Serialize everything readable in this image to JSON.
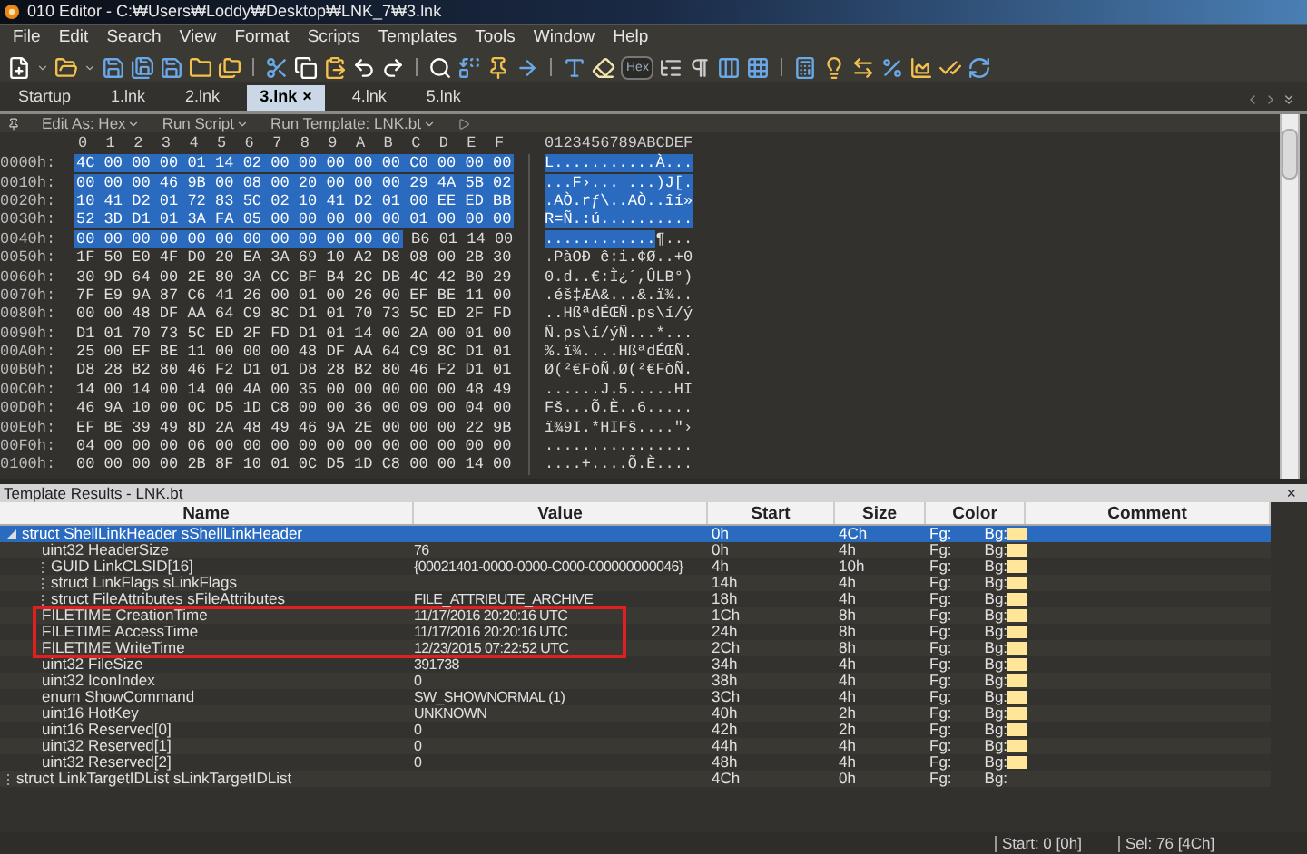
{
  "window": {
    "title": "010 Editor - C:₩Users₩Loddy₩Desktop₩LNK_7₩3.lnk"
  },
  "menu": [
    "File",
    "Edit",
    "Search",
    "View",
    "Format",
    "Scripts",
    "Templates",
    "Tools",
    "Window",
    "Help"
  ],
  "toolbar": {
    "hex_toggle": {
      "label": "Hex",
      "selected": true
    }
  },
  "tabs": [
    {
      "label": "Startup",
      "selected": false
    },
    {
      "label": "1.lnk",
      "selected": false
    },
    {
      "label": "2.lnk",
      "selected": false
    },
    {
      "label": "3.lnk",
      "selected": true,
      "close": "×"
    },
    {
      "label": "4.lnk",
      "selected": false
    },
    {
      "label": "5.lnk",
      "selected": false
    }
  ],
  "editor_bar": {
    "items": [
      "Edit As: Hex",
      "Run Script",
      "Run Template: LNK.bt"
    ]
  },
  "hex": {
    "columns": [
      "0",
      "1",
      "2",
      "3",
      "4",
      "5",
      "6",
      "7",
      "8",
      "9",
      "A",
      "B",
      "C",
      "D",
      "E",
      "F"
    ],
    "ascii_header": "0123456789ABCDEF",
    "rows": [
      {
        "offset": "0000h:",
        "selected_bytes": "4C 00 00 00 01 14 02 00 00 00 00 00 C0 00 00 00",
        "selected_ascii": "L...........À..."
      },
      {
        "offset": "0010h:",
        "selected_bytes": "00 00 00 46 9B 00 08 00 20 00 00 00 29 4A 5B 02",
        "selected_ascii": "...F›... ...)J[."
      },
      {
        "offset": "0020h:",
        "selected_bytes": "10 41 D2 01 72 83 5C 02 10 41 D2 01 00 EE ED BB",
        "selected_ascii": ".AÒ.rƒ\\..AÒ..îí»"
      },
      {
        "offset": "0030h:",
        "selected_bytes": "52 3D D1 01 3A FA 05 00 00 00 00 00 01 00 00 00",
        "selected_ascii": "R=Ñ.:ú.........."
      },
      {
        "offset": "0040h:",
        "selected_bytes": "00 00 00 00 00 00 00 00 00 00 00 00",
        "bytes": "B6 01 14 00",
        "selected_ascii": "............",
        "ascii": "¶..."
      },
      {
        "offset": "0050h:",
        "bytes": "1F 50 E0 4F D0 20 EA 3A 69 10 A2 D8 08 00 2B 30",
        "ascii": ".PàOÐ ê:i.¢Ø..+0"
      },
      {
        "offset": "0060h:",
        "bytes": "30 9D 64 00 2E 80 3A CC BF B4 2C DB 4C 42 B0 29",
        "ascii": "0.d..€:Ì¿´,ÛLB°)"
      },
      {
        "offset": "0070h:",
        "bytes": "7F E9 9A 87 C6 41 26 00 01 00 26 00 EF BE 11 00",
        "ascii": ".éš‡ÆA&...&.ï¾.."
      },
      {
        "offset": "0080h:",
        "bytes": "00 00 48 DF AA 64 C9 8C D1 01 70 73 5C ED 2F FD",
        "ascii": "..HßªdÉŒÑ.ps\\í/ý"
      },
      {
        "offset": "0090h:",
        "bytes": "D1 01 70 73 5C ED 2F FD D1 01 14 00 2A 00 01 00",
        "ascii": "Ñ.ps\\í/ýÑ...*..."
      },
      {
        "offset": "00A0h:",
        "bytes": "25 00 EF BE 11 00 00 00 48 DF AA 64 C9 8C D1 01",
        "ascii": "%.ï¾....HßªdÉŒÑ."
      },
      {
        "offset": "00B0h:",
        "bytes": "D8 28 B2 80 46 F2 D1 01 D8 28 B2 80 46 F2 D1 01",
        "ascii": "Ø(²€FòÑ.Ø(²€FòÑ."
      },
      {
        "offset": "00C0h:",
        "bytes": "14 00 14 00 14 00 4A 00 35 00 00 00 00 00 48 49",
        "ascii": "......J.5.....HI"
      },
      {
        "offset": "00D0h:",
        "bytes": "46 9A 10 00 0C D5 1D C8 00 00 36 00 09 00 04 00",
        "ascii": "Fš...Õ.È..6....."
      },
      {
        "offset": "00E0h:",
        "bytes": "EF BE 39 49 8D 2A 48 49 46 9A 2E 00 00 00 22 9B",
        "ascii": "ï¾9I.*HIFš....\"›"
      },
      {
        "offset": "00F0h:",
        "bytes": "04 00 00 00 06 00 00 00 00 00 00 00 00 00 00 00",
        "ascii": "................"
      },
      {
        "offset": "0100h:",
        "bytes": "00 00 00 00 2B 8F 10 01 0C D5 1D C8 00 00 14 00",
        "ascii": "....+....Õ.È...."
      }
    ]
  },
  "template_results": {
    "title": "Template Results - LNK.bt",
    "close": "×",
    "columns": [
      "Name",
      "Value",
      "Start",
      "Size",
      "Color",
      "Comment"
    ],
    "rows": [
      {
        "name": "struct ShellLinkHeader sShellLinkHeader",
        "start": "0h",
        "size": "4Ch",
        "fg": "Fg:",
        "bg": "Bg:",
        "color": "#ffe699",
        "selected": true,
        "boxed": false,
        "expanded": true,
        "children": [
          {
            "name": "uint32 HeaderSize",
            "value": "76",
            "start": "0h",
            "size": "4h",
            "fg": "Fg:",
            "bg": "Bg:",
            "color": "#ffe699",
            "selected": false,
            "boxed": false
          },
          {
            "name": "GUID LinkCLSID[16]",
            "value": "{00021401-0000-0000-C000-000000000046}",
            "start": "4h",
            "size": "10h",
            "fg": "Fg:",
            "bg": "Bg:",
            "color": "#ffe699",
            "selected": false,
            "boxed": false,
            "expanded": false
          },
          {
            "name": "struct LinkFlags sLinkFlags",
            "start": "14h",
            "size": "4h",
            "fg": "Fg:",
            "bg": "Bg:",
            "color": "#ffe699",
            "selected": false,
            "boxed": false,
            "expanded": false
          },
          {
            "name": "struct FileAttributes sFileAttributes",
            "value": "FILE_ATTRIBUTE_ARCHIVE",
            "start": "18h",
            "size": "4h",
            "fg": "Fg:",
            "bg": "Bg:",
            "color": "#ffe699",
            "selected": false,
            "boxed": false,
            "expanded": false
          },
          {
            "name": "FILETIME CreationTime",
            "value": "11/17/2016 20:20:16 UTC",
            "start": "1Ch",
            "size": "8h",
            "fg": "Fg:",
            "bg": "Bg:",
            "color": "#ffe699",
            "selected": false,
            "boxed": true
          },
          {
            "name": "FILETIME AccessTime",
            "value": "11/17/2016 20:20:16 UTC",
            "start": "24h",
            "size": "8h",
            "fg": "Fg:",
            "bg": "Bg:",
            "color": "#ffe699",
            "selected": false,
            "boxed": true
          },
          {
            "name": "FILETIME WriteTime",
            "value": "12/23/2015 07:22:52 UTC",
            "start": "2Ch",
            "size": "8h",
            "fg": "Fg:",
            "bg": "Bg:",
            "color": "#ffe699",
            "selected": false,
            "boxed": true
          },
          {
            "name": "uint32 FileSize",
            "value": "391738",
            "start": "34h",
            "size": "4h",
            "fg": "Fg:",
            "bg": "Bg:",
            "color": "#ffe699",
            "selected": false,
            "boxed": false
          },
          {
            "name": "uint32 IconIndex",
            "value": "0",
            "start": "38h",
            "size": "4h",
            "fg": "Fg:",
            "bg": "Bg:",
            "color": "#ffe699",
            "selected": false,
            "boxed": false
          },
          {
            "name": "enum ShowCommand",
            "value": "SW_SHOWNORMAL (1)",
            "start": "3Ch",
            "size": "4h",
            "fg": "Fg:",
            "bg": "Bg:",
            "color": "#ffe699",
            "selected": false,
            "boxed": false
          },
          {
            "name": "uint16 HotKey",
            "value": "UNKNOWN",
            "start": "40h",
            "size": "2h",
            "fg": "Fg:",
            "bg": "Bg:",
            "color": "#ffe699",
            "selected": false,
            "boxed": false
          },
          {
            "name": "uint16 Reserved[0]",
            "value": "0",
            "start": "42h",
            "size": "2h",
            "fg": "Fg:",
            "bg": "Bg:",
            "color": "#ffe699",
            "selected": false,
            "boxed": false
          },
          {
            "name": "uint32 Reserved[1]",
            "value": "0",
            "start": "44h",
            "size": "4h",
            "fg": "Fg:",
            "bg": "Bg:",
            "color": "#ffe699",
            "selected": false,
            "boxed": false
          },
          {
            "name": "uint32 Reserved[2]",
            "value": "0",
            "start": "48h",
            "size": "4h",
            "fg": "Fg:",
            "bg": "Bg:",
            "color": "#ffe699",
            "selected": false,
            "boxed": false
          }
        ]
      },
      {
        "name": "struct LinkTargetIDList sLinkTargetIDList",
        "start": "4Ch",
        "size": "0h",
        "fg": "Fg:",
        "bg": "Bg:",
        "selected": false,
        "boxed": false,
        "expanded": false
      }
    ]
  },
  "status_bar": [
    "Start: 0 [0h]",
    "Sel: 76 [4Ch]"
  ]
}
